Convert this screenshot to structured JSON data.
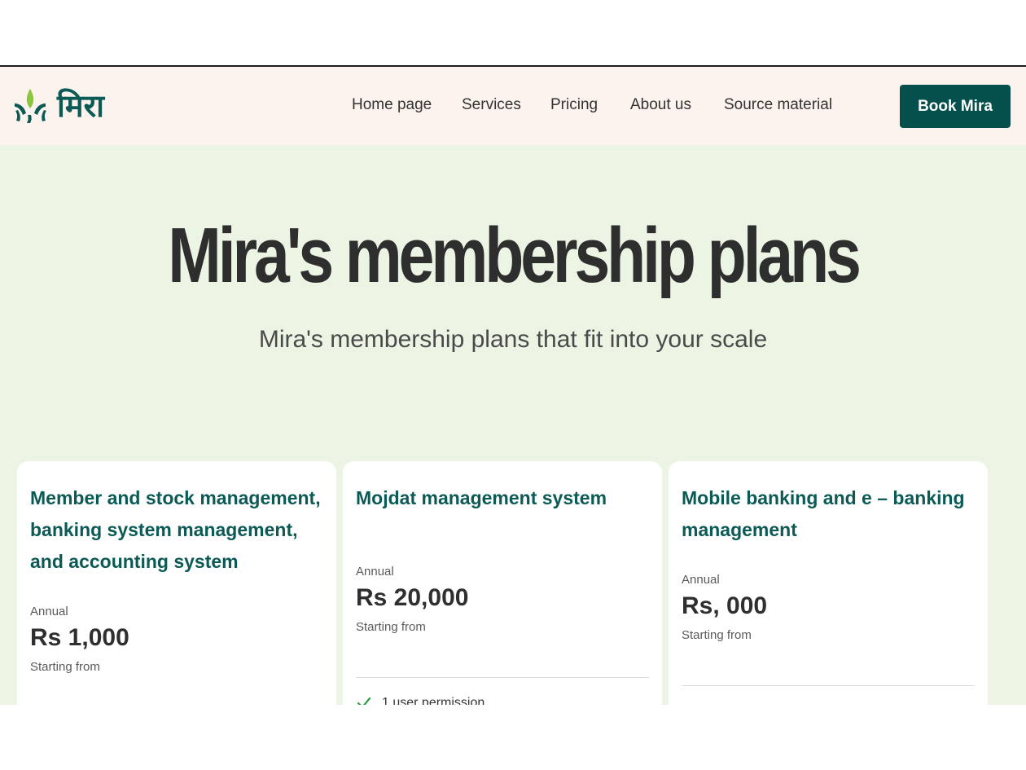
{
  "brand": {
    "name": "मिरा",
    "colors": {
      "primary": "#05504c",
      "accent_leaf": "#8cc63f",
      "nav_bg": "#fdf3ee",
      "hero_bg": "#ecf5e4"
    }
  },
  "nav": {
    "items": [
      {
        "label": "Home page"
      },
      {
        "label": "Services"
      },
      {
        "label": "Pricing"
      },
      {
        "label": "About us"
      },
      {
        "label": "Source material"
      }
    ],
    "cta_label": "Book Mira"
  },
  "hero": {
    "title": "Mira's membership plans",
    "subtitle": "Mira's membership plans that fit into your scale"
  },
  "plans": [
    {
      "title": "Member and stock management, banking system management, and accounting system",
      "period": "Annual",
      "price": "Rs 1,000",
      "starting": "Starting from"
    },
    {
      "title": "Mojdat management system",
      "period": "Annual",
      "price": "Rs 20,000",
      "starting": "Starting from",
      "features": [
        {
          "label": "1 user permission",
          "icon": "check-icon"
        }
      ]
    },
    {
      "title": "Mobile banking and e – banking management",
      "period": "Annual",
      "price": "Rs, 000",
      "starting": "Starting from",
      "features": [
        {
          "label": "",
          "icon": "check-icon"
        }
      ]
    }
  ]
}
